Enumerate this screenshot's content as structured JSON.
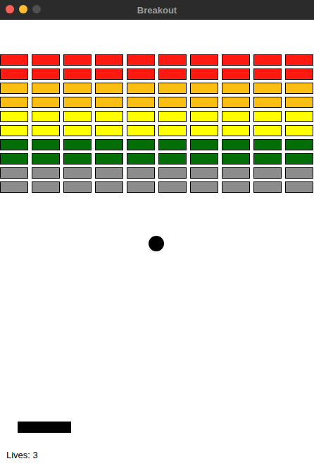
{
  "window": {
    "title": "Breakout"
  },
  "bricks": {
    "rows": [
      {
        "color": "#fe1a10",
        "count": 10
      },
      {
        "color": "#fe1a10",
        "count": 10
      },
      {
        "color": "#fbbe12",
        "count": 10
      },
      {
        "color": "#fbbe12",
        "count": 10
      },
      {
        "color": "#ffff00",
        "count": 10
      },
      {
        "color": "#ffff00",
        "count": 10
      },
      {
        "color": "#036d07",
        "count": 10
      },
      {
        "color": "#036d07",
        "count": 10
      },
      {
        "color": "#8c8c8c",
        "count": 10
      },
      {
        "color": "#8c8c8c",
        "count": 10
      }
    ]
  },
  "status": {
    "lives": "Lives: 3"
  }
}
